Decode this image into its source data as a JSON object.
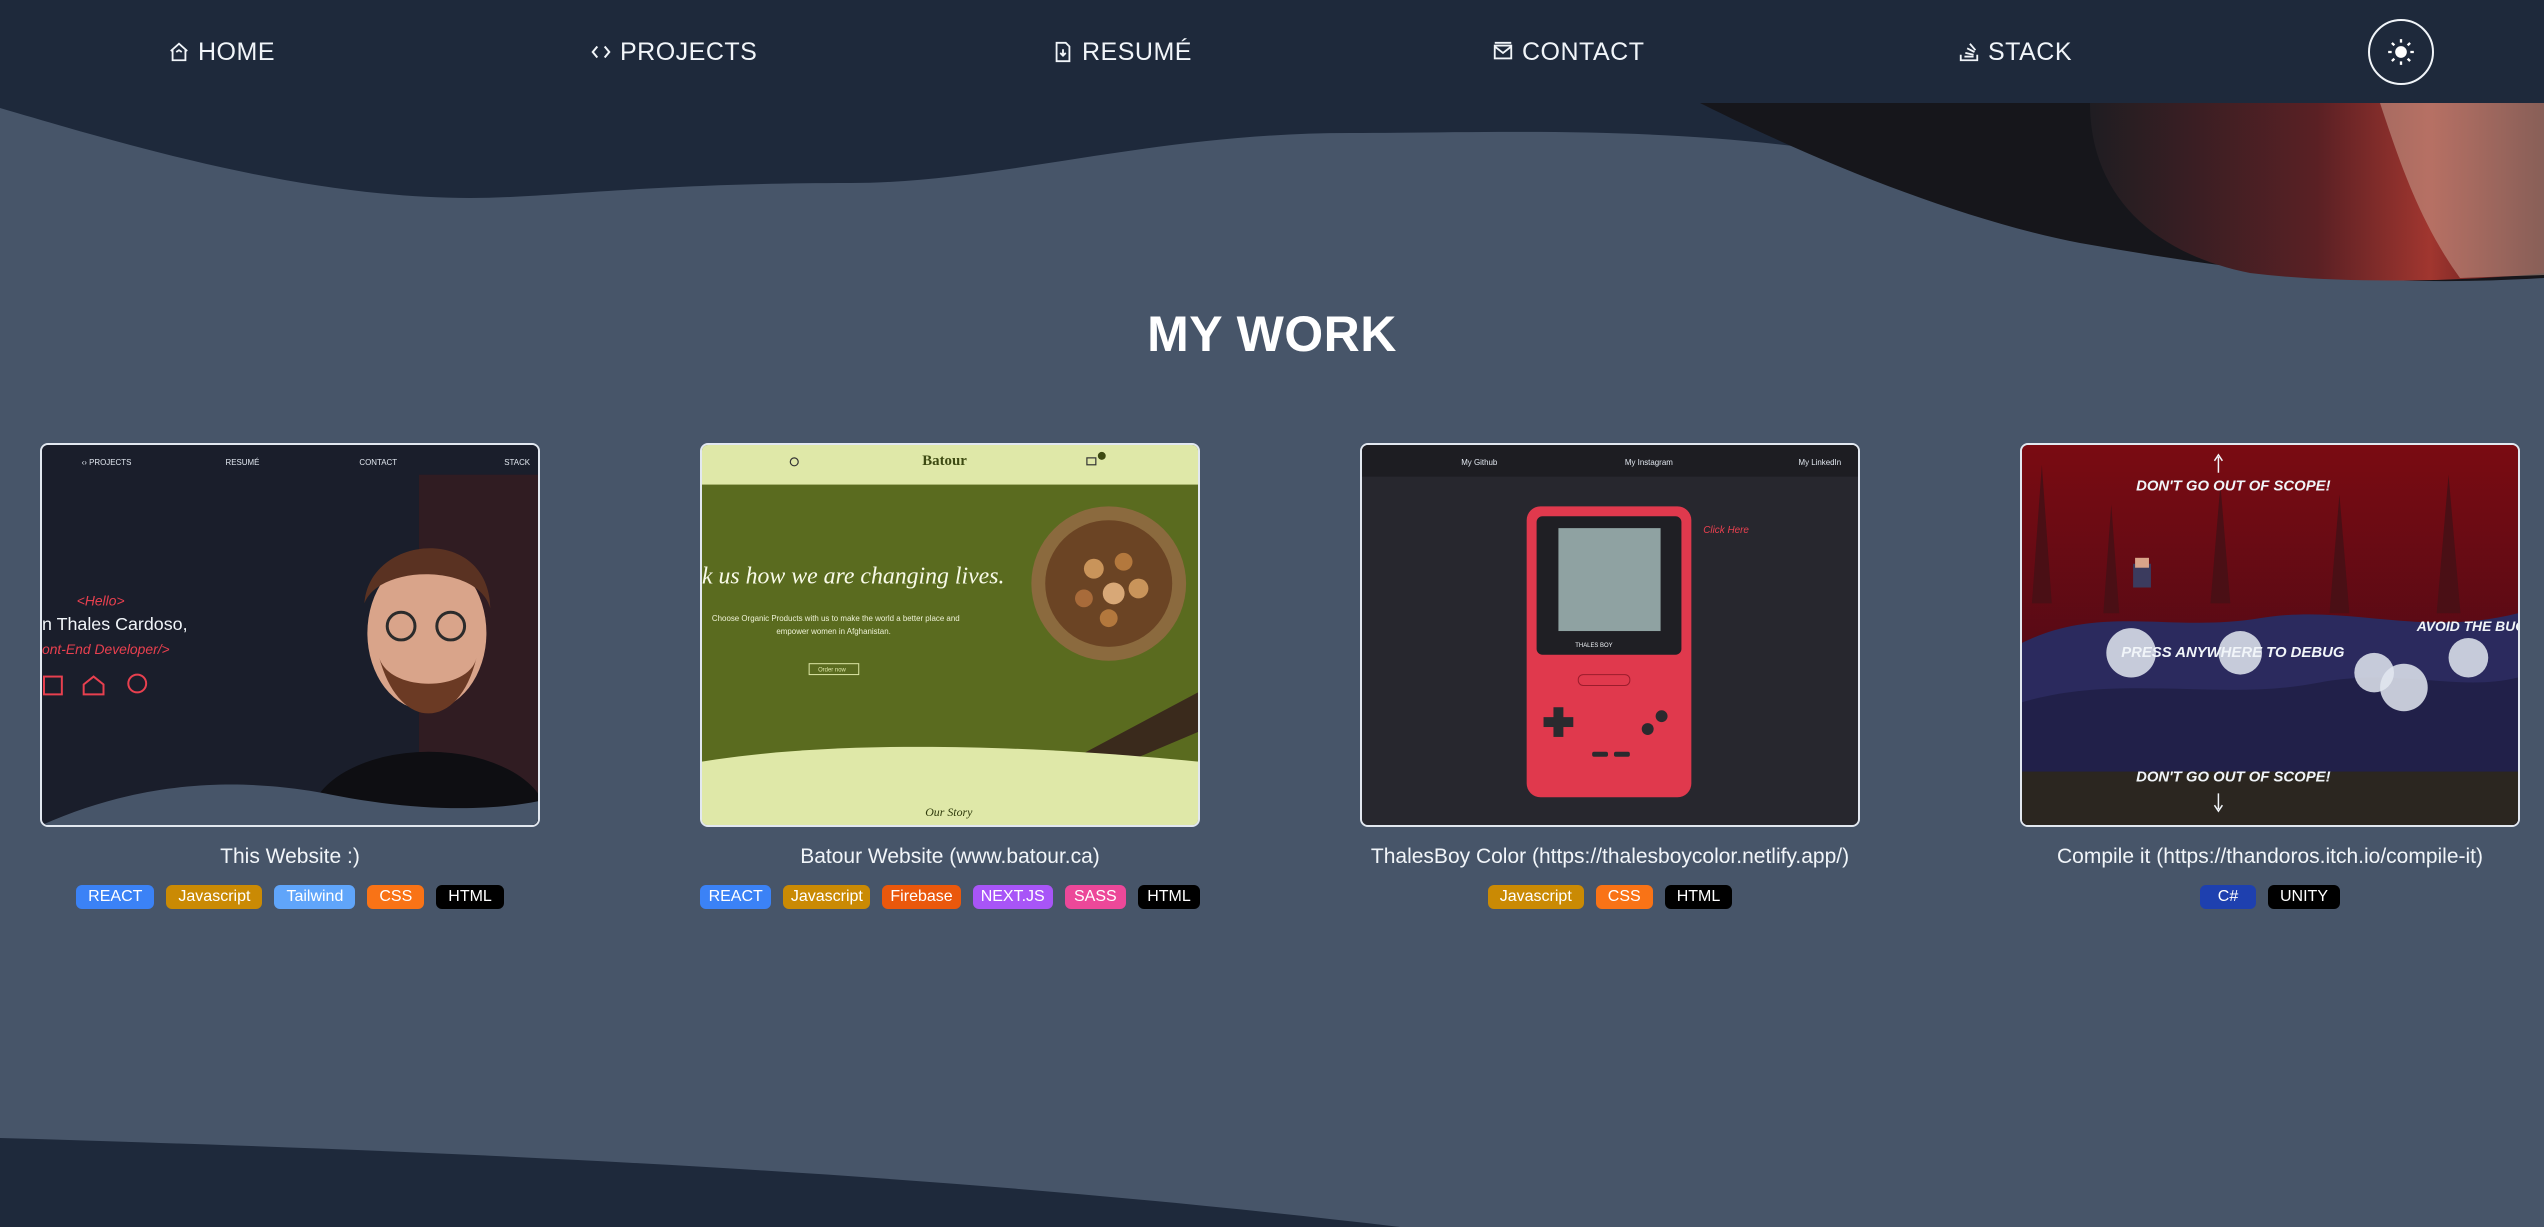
{
  "nav": {
    "home": "HOME",
    "projects": "PROJECTS",
    "resume": "RESUMÉ",
    "contact": "CONTACT",
    "stack": "STACK"
  },
  "section": {
    "title": "MY WORK"
  },
  "projects": [
    {
      "title": "This Website :)",
      "tags": [
        "REACT",
        "Javascript",
        "Tailwind",
        "CSS",
        "HTML"
      ],
      "preview": {
        "nav": [
          "‹› PROJECTS",
          "RESUMÉ",
          "CONTACT",
          "STACK"
        ],
        "hello": "<Hello>",
        "name": "n Thales Cardoso,",
        "role": "ont-End Developer/>"
      }
    },
    {
      "title": "Batour Website (www.batour.ca)",
      "tags": [
        "REACT",
        "Javascript",
        "Firebase",
        "NEXT.JS",
        "SASS",
        "HTML"
      ],
      "preview": {
        "logo": "Batour",
        "headline": "k us how we are changing lives.",
        "sub1": "Choose Organic Products with us to make the world a better place and",
        "sub2": "empower women in Afghanistan.",
        "button": "Order now",
        "story": "Our Story"
      }
    },
    {
      "title": "ThalesBoy Color (https://thalesboycolor.netlify.app/)",
      "tags": [
        "Javascript",
        "CSS",
        "HTML"
      ],
      "preview": {
        "links": [
          "My Github",
          "My Instagram",
          "My LinkedIn"
        ],
        "click": "Click Here",
        "brand": "THALES BOY"
      }
    },
    {
      "title": "Compile it (https://thandoros.itch.io/compile-it)",
      "tags": [
        "C#",
        "UNITY"
      ],
      "preview": {
        "top": "DON'T GO OUT OF SCOPE!",
        "middle": "PRESS ANYWHERE TO DEBUG",
        "right": "AVOID THE BUG",
        "bottom": "DON'T GO OUT OF SCOPE!"
      }
    }
  ],
  "tag_colors": {
    "REACT": "#3b82f6",
    "Javascript": "#ca8a04",
    "Tailwind": "#60a5fa",
    "CSS": "#f97316",
    "HTML": "#000000",
    "Firebase": "#ea580c",
    "NEXT.JS": "#a855f7",
    "SASS": "#ec4899",
    "C#": "#1e40af",
    "UNITY": "#000000"
  },
  "colors": {
    "nav_bg": "#1e293b",
    "page_bg": "#475569",
    "accent_red": "#e8404f"
  }
}
